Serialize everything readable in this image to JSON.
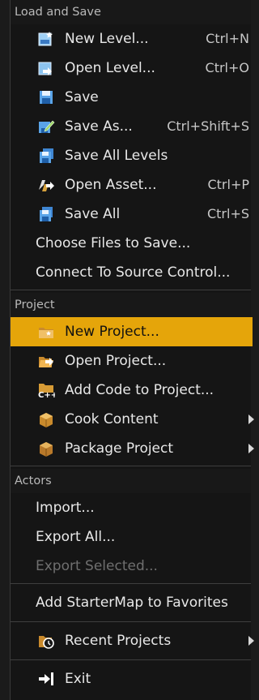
{
  "menu": {
    "load_and_save": {
      "header": "Load and Save",
      "items": [
        {
          "label": "New Level...",
          "shortcut": "Ctrl+N",
          "icon": "new-level-icon"
        },
        {
          "label": "Open Level...",
          "shortcut": "Ctrl+O",
          "icon": "open-level-icon"
        },
        {
          "label": "Save",
          "shortcut": "",
          "icon": "save-icon"
        },
        {
          "label": "Save As...",
          "shortcut": "Ctrl+Shift+S",
          "icon": "save-as-icon"
        },
        {
          "label": "Save All Levels",
          "shortcut": "",
          "icon": "save-all-levels-icon"
        },
        {
          "label": "Open Asset...",
          "shortcut": "Ctrl+P",
          "icon": "open-asset-icon"
        },
        {
          "label": "Save All",
          "shortcut": "Ctrl+S",
          "icon": "save-all-icon"
        },
        {
          "label": "Choose Files to Save...",
          "shortcut": ""
        },
        {
          "label": "Connect To Source Control...",
          "shortcut": ""
        }
      ]
    },
    "project": {
      "header": "Project",
      "items": [
        {
          "label": "New Project...",
          "icon": "new-project-icon",
          "highlighted": true
        },
        {
          "label": "Open Project...",
          "icon": "open-project-icon"
        },
        {
          "label": "Add Code to Project...",
          "icon": "add-code-icon"
        },
        {
          "label": "Cook Content",
          "icon": "cook-content-icon",
          "submenu": true
        },
        {
          "label": "Package Project",
          "icon": "package-project-icon",
          "submenu": true
        }
      ]
    },
    "actors": {
      "header": "Actors",
      "items": [
        {
          "label": "Import..."
        },
        {
          "label": "Export All..."
        },
        {
          "label": "Export Selected...",
          "disabled": true
        }
      ]
    },
    "favorites": {
      "items": [
        {
          "label": "Add StarterMap to Favorites"
        }
      ]
    },
    "recent": {
      "items": [
        {
          "label": "Recent Projects",
          "icon": "recent-projects-icon",
          "submenu": true
        }
      ]
    },
    "exit": {
      "items": [
        {
          "label": "Exit",
          "icon": "exit-icon"
        }
      ]
    },
    "colors": {
      "highlight": "#e5a50a",
      "background": "#151515",
      "disabled_text": "#6f6f6f"
    }
  }
}
